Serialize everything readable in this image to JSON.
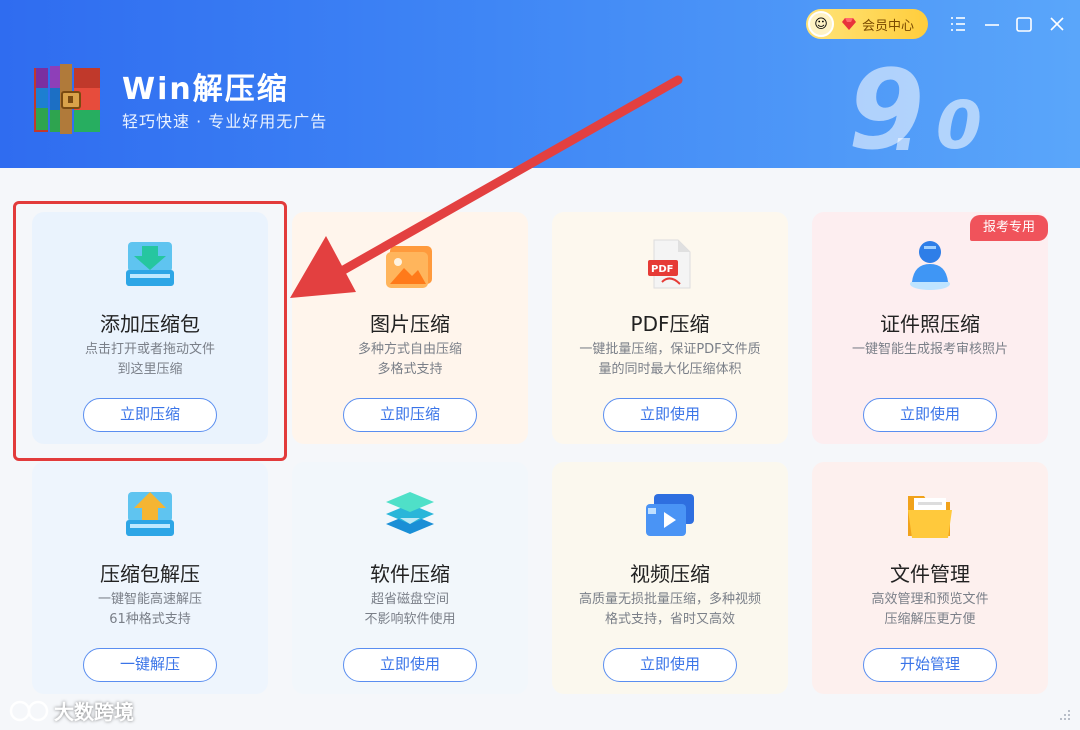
{
  "header": {
    "app_title": "Win解压缩",
    "subtitle": "轻巧快速 · 专业好用无广告",
    "version_major": "9",
    "version_minor": "0",
    "vip_label": "会员中心"
  },
  "cards": [
    {
      "title": "添加压缩包",
      "desc1": "点击打开或者拖动文件",
      "desc2": "到这里压缩",
      "button": "立即压缩",
      "icon": "add-archive-icon"
    },
    {
      "title": "图片压缩",
      "desc1": "多种方式自由压缩",
      "desc2": "多格式支持",
      "button": "立即压缩",
      "icon": "image-icon"
    },
    {
      "title": "PDF压缩",
      "desc1": "一键批量压缩，保证PDF文件质",
      "desc2": "量的同时最大化压缩体积",
      "button": "立即使用",
      "icon": "pdf-icon"
    },
    {
      "title": "证件照压缩",
      "desc1": "一键智能生成报考审核照片",
      "desc2": "",
      "button": "立即使用",
      "icon": "id-photo-icon"
    },
    {
      "title": "压缩包解压",
      "desc1": "一键智能高速解压",
      "desc2": "61种格式支持",
      "button": "一键解压",
      "icon": "extract-icon"
    },
    {
      "title": "软件压缩",
      "desc1": "超省磁盘空间",
      "desc2": "不影响软件使用",
      "button": "立即使用",
      "icon": "software-layers-icon"
    },
    {
      "title": "视频压缩",
      "desc1": "高质量无损批量压缩，多种视频",
      "desc2": "格式支持，省时又高效",
      "button": "立即使用",
      "icon": "video-icon"
    },
    {
      "title": "文件管理",
      "desc1": "高效管理和预览文件",
      "desc2": "压缩解压更方便",
      "button": "开始管理",
      "icon": "folder-icon"
    }
  ],
  "badge": "报考专用",
  "watermark": "大数跨境",
  "colors": {
    "accent": "#3a74e8",
    "header_start": "#2f6cf0",
    "highlight": "#e23b3b",
    "badge": "#f0535b"
  }
}
